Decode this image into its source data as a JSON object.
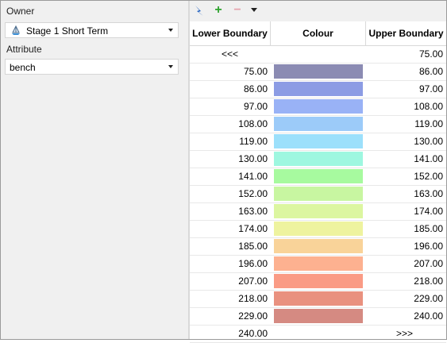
{
  "left_panel": {
    "owner_label": "Owner",
    "owner_value": "Stage 1 Short Term",
    "owner_icon": "survey-stage-icon",
    "attribute_label": "Attribute",
    "attribute_value": "bench"
  },
  "toolbar": {
    "icons": [
      "lightning-icon",
      "add-icon",
      "remove-icon",
      "chevron-down-icon"
    ],
    "add_glyph": "+",
    "remove_glyph": "−"
  },
  "table": {
    "columns": [
      "Lower Boundary",
      "Colour",
      "Upper Boundary"
    ],
    "rows": [
      {
        "lower": "<<<",
        "colour": null,
        "upper": "75.00"
      },
      {
        "lower": "75.00",
        "colour": "#8b8bb3",
        "upper": "86.00"
      },
      {
        "lower": "86.00",
        "colour": "#8c9ce4",
        "upper": "97.00"
      },
      {
        "lower": "97.00",
        "colour": "#99b2f6",
        "upper": "108.00"
      },
      {
        "lower": "108.00",
        "colour": "#9ccbf9",
        "upper": "119.00"
      },
      {
        "lower": "119.00",
        "colour": "#9ce0fb",
        "upper": "130.00"
      },
      {
        "lower": "130.00",
        "colour": "#9ef7e0",
        "upper": "141.00"
      },
      {
        "lower": "141.00",
        "colour": "#a7fa9f",
        "upper": "152.00"
      },
      {
        "lower": "152.00",
        "colour": "#c8f6a1",
        "upper": "163.00"
      },
      {
        "lower": "163.00",
        "colour": "#dcf6a0",
        "upper": "174.00"
      },
      {
        "lower": "174.00",
        "colour": "#eef39f",
        "upper": "185.00"
      },
      {
        "lower": "185.00",
        "colour": "#f9d399",
        "upper": "196.00"
      },
      {
        "lower": "196.00",
        "colour": "#fdb190",
        "upper": "207.00"
      },
      {
        "lower": "207.00",
        "colour": "#fa9b85",
        "upper": "218.00"
      },
      {
        "lower": "218.00",
        "colour": "#e9917f",
        "upper": "229.00"
      },
      {
        "lower": "229.00",
        "colour": "#d58a82",
        "upper": "240.00"
      },
      {
        "lower": "240.00",
        "colour": null,
        "upper": ">>>"
      }
    ]
  }
}
